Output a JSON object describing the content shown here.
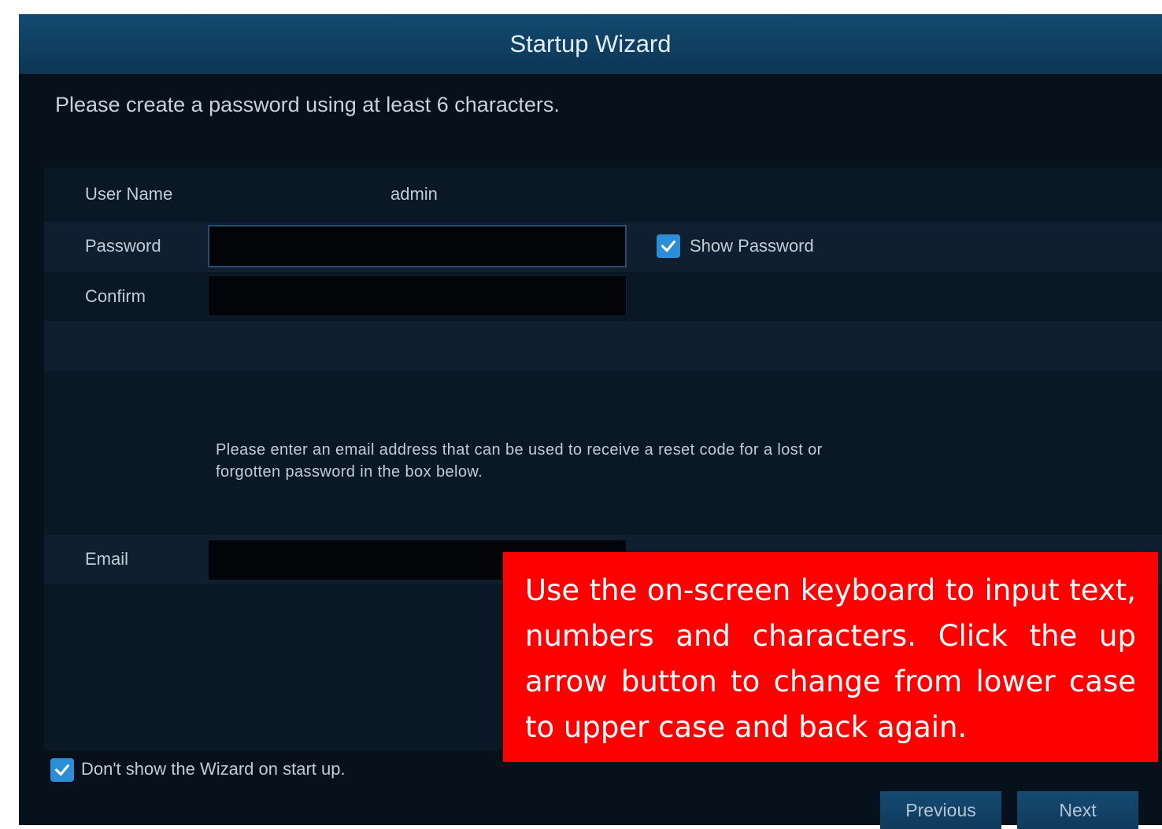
{
  "window": {
    "title": "Startup Wizard"
  },
  "instruction": "Please create a password using at least 6 characters.",
  "form": {
    "username_label": "User Name",
    "username_value": "admin",
    "password_label": "Password",
    "password_value": "",
    "show_password_label": "Show Password",
    "show_password_checked": true,
    "confirm_label": "Confirm",
    "confirm_value": "",
    "email_note": "Please enter an email address that can be used to receive a reset code for a lost or forgotten password in the box below.",
    "email_label": "Email",
    "email_value": ""
  },
  "footer": {
    "dont_show_label": "Don't show the Wizard on start up.",
    "dont_show_checked": true,
    "previous_label": "Previous",
    "next_label": "Next"
  },
  "callout": {
    "text": "Use the on-screen keyboard to input text, numbers and characters. Click the up arrow button to change from lower case to upper case and back again."
  },
  "colors": {
    "title_bar": "#0c3654",
    "checkbox": "#2c8ed6",
    "callout_bg": "#ff0000",
    "window_bg": "#07111c"
  }
}
